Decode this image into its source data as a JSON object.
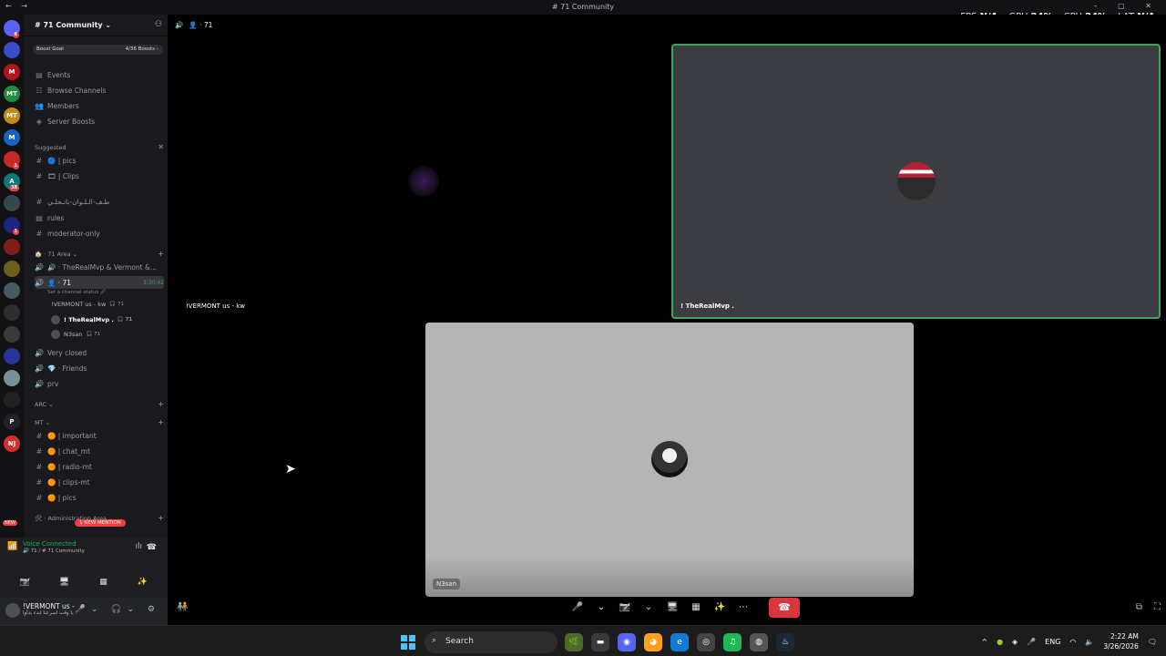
{
  "window": {
    "title": "# 71 Community",
    "nav_icons": "← →",
    "controls": "– ▢ ✕"
  },
  "overlay": {
    "fps_label": "FPS",
    "fps_value": "N/A",
    "gpu_label": "GPU",
    "gpu_value": "24%",
    "cpu_label": "CPU",
    "cpu_value": "24%",
    "lat_label": "LAT",
    "lat_value": "N/A"
  },
  "rail": {
    "servers": [
      {
        "label": "",
        "color": "#5865f2",
        "badge": "6"
      },
      {
        "label": "",
        "color": "#3b4cca",
        "badge": ""
      },
      {
        "label": "M",
        "color": "#b5121b",
        "badge": ""
      },
      {
        "label": "MT",
        "color": "#1e8e3e",
        "badge": ""
      },
      {
        "label": "MT",
        "color": "#c98a14",
        "badge": ""
      },
      {
        "label": "M",
        "color": "#1565c0",
        "badge": ""
      },
      {
        "label": "",
        "color": "#c62828",
        "badge": "1"
      },
      {
        "label": "A",
        "color": "#0b7a75",
        "badge": "38"
      },
      {
        "label": "",
        "color": "#37474f",
        "badge": ""
      },
      {
        "label": "",
        "color": "#1a237e",
        "badge": "1"
      },
      {
        "label": "",
        "color": "#7f1d1d",
        "badge": ""
      },
      {
        "label": "",
        "color": "#6d5d1a",
        "badge": ""
      },
      {
        "label": "",
        "color": "#455a64",
        "badge": ""
      },
      {
        "label": "",
        "color": "#2e2e2e",
        "badge": ""
      },
      {
        "label": "",
        "color": "#3a3a3a",
        "badge": ""
      },
      {
        "label": "",
        "color": "#283593",
        "badge": ""
      },
      {
        "label": "",
        "color": "#78909c",
        "badge": ""
      },
      {
        "label": "",
        "color": "#222",
        "badge": ""
      },
      {
        "label": "P",
        "color": "#202225",
        "badge": ""
      },
      {
        "label": "NJ",
        "color": "#d32f2f",
        "badge": ""
      }
    ],
    "new_label": "NEW"
  },
  "server": {
    "name": "# 71 Community ⌄",
    "boost_goal": "Boost Goal",
    "boost_count": "4/36 Boosts ›"
  },
  "menu": [
    {
      "icon": "▤",
      "label": "Events"
    },
    {
      "icon": "☷",
      "label": "Browse Channels"
    },
    {
      "icon": "👥",
      "label": "Members"
    },
    {
      "icon": "◈",
      "label": "Server Boosts"
    }
  ],
  "suggested": {
    "label": "Suggested",
    "close": "✕",
    "channels": [
      {
        "icon": "#",
        "label": "🔵 | pics"
      },
      {
        "icon": "#",
        "label": "🎞 | Clips"
      }
    ]
  },
  "channels_top": [
    {
      "icon": "#",
      "label": "طـف-الـلـوان-باتـحلـي"
    },
    {
      "icon": "▤",
      "label": "rules"
    },
    {
      "icon": "#",
      "label": "moderator-only"
    }
  ],
  "area71": {
    "category": "🏠 · 71 Area ⌄",
    "plus": "+",
    "voice1": "🔊 · TheRealMvp & Vermont &...",
    "active_channel": "👤 · 71",
    "active_timer": "3:30:42",
    "status_hint": "Set a channel status 🖉",
    "users": [
      {
        "name": "!VERMONT us - kw",
        "tag": "🎧 71"
      },
      {
        "name": "! TheRealMvp .",
        "tag": "🎧 71"
      },
      {
        "name": "N3san",
        "tag": "🎧 71"
      }
    ],
    "voice_rest": [
      {
        "icon": "🔊",
        "label": "Very closed"
      },
      {
        "icon": "🔊",
        "label": "💎 · Friends"
      },
      {
        "icon": "🔊",
        "label": "prv"
      }
    ]
  },
  "arc": {
    "category": "ARC ⌄",
    "plus": "+"
  },
  "mt": {
    "category": "MT ⌄",
    "plus": "+",
    "channels": [
      {
        "icon": "#",
        "label": "🟠 | important"
      },
      {
        "icon": "#",
        "label": "🟠 | chat_mt"
      },
      {
        "icon": "#",
        "label": "🟠 | radio-mt"
      },
      {
        "icon": "#",
        "label": "🟠 | clips-mt"
      },
      {
        "icon": "#",
        "label": "🟠 | pics"
      }
    ]
  },
  "admin": {
    "category": "🛠 · Administration Area ⌄",
    "plus": "+"
  },
  "mention": "1 NEW MENTION",
  "voice": {
    "status": "Voice Connected",
    "channel": "🔊 71 / # 71 Community",
    "wave": "ılı",
    "hangup": "☎",
    "buttons": [
      "📷̸",
      "🖥",
      "▦",
      "✨"
    ]
  },
  "user": {
    "name": "!VERMONT us -",
    "status": "يا وقت اسرعنا لبدء بدأوا ⁝",
    "controls": "🎤⌄ 🎧⌄ ⚙"
  },
  "stage": {
    "channel_title": "👤 · 71",
    "toggle": "🔊",
    "tiles": [
      {
        "name": "!VERMONT us - kw"
      },
      {
        "name": "! TheRealMvp ."
      },
      {
        "name": "N3san"
      }
    ],
    "controls": [
      "🎤",
      "⌄",
      "📷̸",
      "⌄",
      "🖥",
      "▦",
      "✨",
      "⋯"
    ],
    "end_call": "☎",
    "activity": "🧑‍🤝‍🧑",
    "popout": "⧉",
    "fullscreen": "⛶"
  },
  "taskbar": {
    "search_icon": "⌕",
    "search_placeholder": "Search",
    "apps": [
      {
        "label": "🌿",
        "color": "#4a6b2a"
      },
      {
        "label": "▬",
        "color": "#3a3a3a"
      },
      {
        "label": "◉",
        "color": "#5865f2"
      },
      {
        "label": "◕",
        "color": "#ff9f1c"
      },
      {
        "label": "e",
        "color": "#0f7bd8"
      },
      {
        "label": "◎",
        "color": "#444"
      },
      {
        "label": "♫",
        "color": "#1db954"
      },
      {
        "label": "◍",
        "color": "#555"
      },
      {
        "label": "♨",
        "color": "#1b2838"
      }
    ],
    "tray": {
      "chevron": "^",
      "lang": "ENG",
      "time": "2:22 AM",
      "date": "3/26/2026"
    }
  }
}
